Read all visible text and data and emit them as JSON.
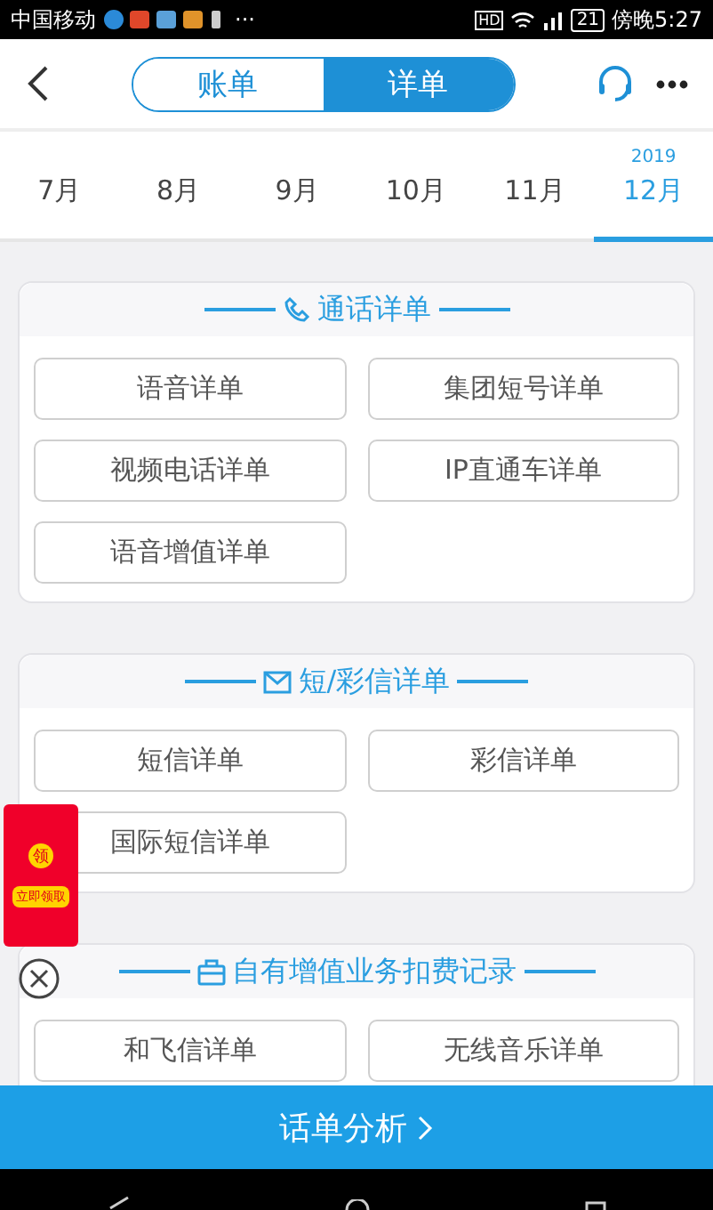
{
  "status_bar": {
    "carrier": "中国移动",
    "more": "···",
    "hd": "HD",
    "battery": "21",
    "time": "傍晚5:27"
  },
  "header": {
    "segments": [
      {
        "label": "账单",
        "selected": false
      },
      {
        "label": "详单",
        "selected": true
      }
    ]
  },
  "months": [
    {
      "label": "7月",
      "selected": false
    },
    {
      "label": "8月",
      "selected": false
    },
    {
      "label": "9月",
      "selected": false
    },
    {
      "label": "10月",
      "selected": false
    },
    {
      "label": "11月",
      "selected": false
    },
    {
      "label": "12月",
      "year": "2019",
      "selected": true
    }
  ],
  "sections": [
    {
      "title": "通话详单",
      "kind": "call",
      "buttons": [
        "语音详单",
        "集团短号详单",
        "视频电话详单",
        "IP直通车详单",
        "语音增值详单"
      ]
    },
    {
      "title": "短/彩信详单",
      "kind": "message",
      "buttons": [
        "短信详单",
        "彩信详单",
        "国际短信详单"
      ]
    },
    {
      "title": "自有增值业务扣费记录",
      "kind": "service",
      "buttons": [
        "和飞信详单",
        "无线音乐详单"
      ]
    }
  ],
  "promo": {
    "badge": "领",
    "label": "立即领取"
  },
  "bottom_button": {
    "label": "话单分析"
  }
}
